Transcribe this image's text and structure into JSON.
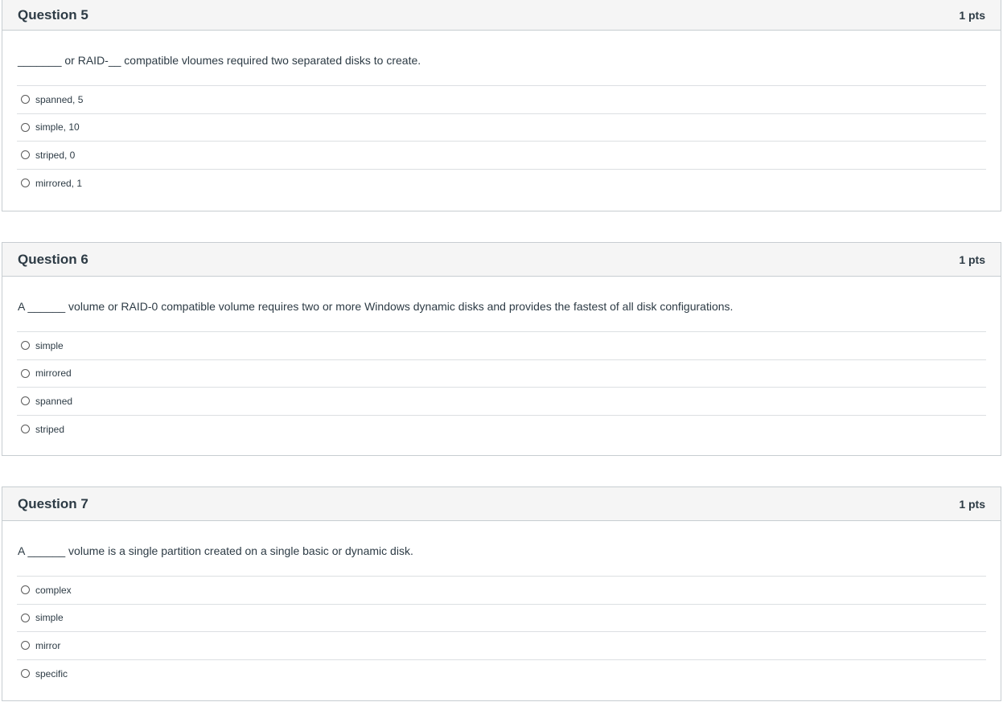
{
  "questions": [
    {
      "title": "Question 5",
      "points": "1 pts",
      "text": "_______ or RAID-__ compatible vloumes required two separated disks to create.",
      "answers": [
        "spanned, 5",
        "simple, 10",
        "striped, 0",
        "mirrored, 1"
      ]
    },
    {
      "title": "Question 6",
      "points": "1 pts",
      "text": "A ______ volume or RAID-0 compatible volume requires two or more Windows dynamic disks and provides the fastest of all disk configurations.",
      "answers": [
        "simple",
        "mirrored",
        "spanned",
        "striped"
      ]
    },
    {
      "title": "Question 7",
      "points": "1 pts",
      "text": "A ______ volume is a single partition created on a single basic or dynamic disk.",
      "answers": [
        "complex",
        "simple",
        "mirror",
        "specific"
      ]
    }
  ]
}
